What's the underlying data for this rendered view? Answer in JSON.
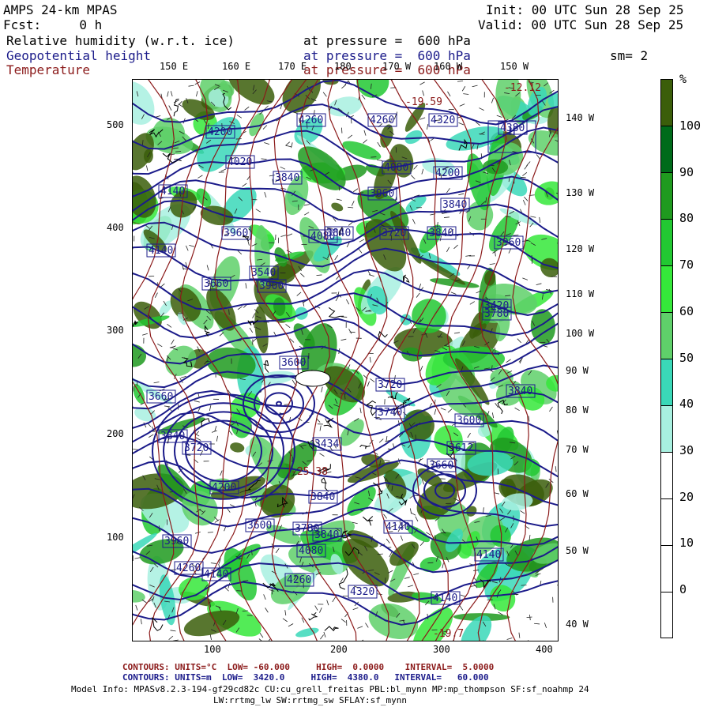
{
  "header": {
    "model": "AMPS 24-km MPAS",
    "forecast": "Fcst:     0 h",
    "init": "Init: 00 UTC Sun 28 Sep 25",
    "valid": "Valid: 00 UTC Sun 28 Sep 25",
    "fields": [
      {
        "name": "Relative humidity (w.r.t. ice)",
        "level": "at pressure =  600 hPa",
        "color": "#000000"
      },
      {
        "name": "Geopotential height",
        "level": "at pressure =  600 hPa",
        "color": "#1b1b8a"
      },
      {
        "name": "Temperature",
        "level": "at pressure =  600 hPa",
        "color": "#8b1a1a"
      }
    ],
    "smoothing": "sm= 2"
  },
  "map": {
    "top_lon_labels": [
      "150 E",
      "160 E",
      "170 E",
      "180",
      "170 W",
      "160 W",
      "150 W"
    ],
    "right_lon_labels": [
      "140 W",
      "130 W",
      "120 W",
      "110 W",
      "100 W",
      "90 W",
      "80 W",
      "70 W",
      "60 W",
      "50 W",
      "40 W"
    ],
    "y_ticks": [
      "500",
      "400",
      "300",
      "200",
      "100"
    ],
    "x_ticks": [
      "100",
      "200",
      "300",
      "400"
    ],
    "height_contour_labels": [
      "4260",
      "4260",
      "4320",
      "4380",
      "4200",
      "4020",
      "3840",
      "4080",
      "4200",
      "4140",
      "3960",
      "3840",
      "3960",
      "4080",
      "3840",
      "3720",
      "3840",
      "3960",
      "4140",
      "3660",
      "3540",
      "3900",
      "3420",
      "3780",
      "3600",
      "3720",
      "3840",
      "3660",
      "3740",
      "3600",
      "3840",
      "3720",
      "3434",
      "3612",
      "3660",
      "4200",
      "3840",
      "3600",
      "3780",
      "3840",
      "4140",
      "3960",
      "4080",
      "4140",
      "4260",
      "4140",
      "4260",
      "4320",
      "4140"
    ],
    "temp_contour_labels": [
      "-19.59",
      "-12.12",
      "-25.38",
      "-19.7"
    ],
    "high_label": "H"
  },
  "colorbar": {
    "unit": "%",
    "labels": [
      "100",
      "90",
      "80",
      "70",
      "60",
      "50",
      "40",
      "30",
      "20",
      "10",
      "0"
    ],
    "colors": [
      "#3b5e0a",
      "#006b1a",
      "#1f9a1f",
      "#22c832",
      "#35e83a",
      "#5fd06a",
      "#3ad8b8",
      "#a8f0e0",
      "#ffffff",
      "#ffffff",
      "#ffffff"
    ]
  },
  "footer": {
    "line1": {
      "label": "CONTOURS:",
      "units": "UNITS=°C",
      "low": "LOW= -60.000",
      "high": "HIGH=  0.0000",
      "interval": "INTERVAL=  5.0000",
      "color": "#8b1a1a"
    },
    "line2": {
      "label": "CONTOURS:",
      "units": "UNITS=m",
      "low": "LOW=  3420.0",
      "high": "HIGH=  4380.0",
      "interval": "INTERVAL=   60.000",
      "color": "#1b1b8a"
    },
    "info1": "Model Info: MPASv8.2.3-194-gf29cd82c CU:cu_grell_freitas PBL:bl_mynn MP:mp_thompson SF:sf_noahmp 24",
    "info2": "LW:rrtmg_lw SW:rrtmg_sw SFLAY:sf_mynn"
  }
}
